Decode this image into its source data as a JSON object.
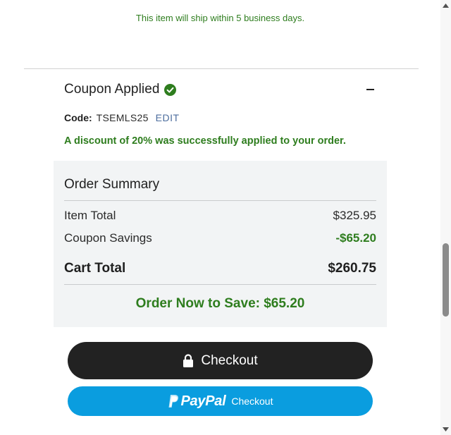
{
  "shipping_note": "This item will ship within 5 business days.",
  "coupon": {
    "title": "Coupon Applied",
    "code_label": "Code:",
    "code_value": "TSEMLS25",
    "edit_label": "EDIT",
    "discount_message": "A discount of 20% was successfully applied to your order."
  },
  "summary": {
    "title": "Order Summary",
    "item_total_label": "Item Total",
    "item_total_value": "$325.95",
    "coupon_savings_label": "Coupon Savings",
    "coupon_savings_value": "-$65.20",
    "cart_total_label": "Cart Total",
    "cart_total_value": "$260.75",
    "save_banner": "Order Now to Save: $65.20"
  },
  "buttons": {
    "checkout_label": "Checkout",
    "paypal_brand": "PayPal",
    "paypal_label": "Checkout"
  },
  "colors": {
    "green": "#2e7d1e",
    "summary_bg": "#f2f4f5",
    "checkout_bg": "#222222",
    "paypal_bg": "#0a9ddf",
    "edit_link": "#4d6e9e"
  },
  "icons": {
    "coupon_status": "check-circle-icon",
    "checkout": "lock-icon",
    "paypal": "paypal-logo-icon",
    "collapse": "minus-icon"
  }
}
